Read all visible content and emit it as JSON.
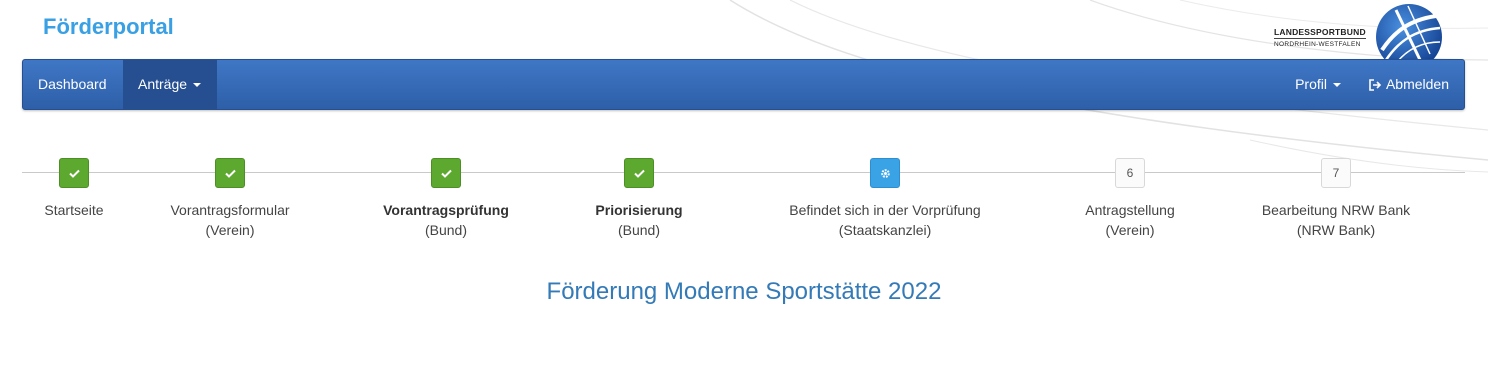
{
  "brand": {
    "title": "Förderportal"
  },
  "logo": {
    "line1": "LANDESSPORTBUND",
    "line2": "NORDRHEIN-WESTFALEN"
  },
  "nav": {
    "left": [
      {
        "label": "Dashboard",
        "active": false,
        "dropdown": false
      },
      {
        "label": "Anträge",
        "active": true,
        "dropdown": true
      }
    ],
    "profile_label": "Profil",
    "logout_label": "Abmelden"
  },
  "steps": [
    {
      "state": "done",
      "badge": "",
      "title": "Startseite",
      "subtitle": "",
      "bold": false
    },
    {
      "state": "done",
      "badge": "",
      "title": "Vorantragsformular",
      "subtitle": "(Verein)",
      "bold": false
    },
    {
      "state": "done",
      "badge": "",
      "title": "Vorantragsprüfung",
      "subtitle": "(Bund)",
      "bold": true
    },
    {
      "state": "done",
      "badge": "",
      "title": "Priorisierung",
      "subtitle": "(Bund)",
      "bold": true
    },
    {
      "state": "current",
      "badge": "",
      "title": "Befindet sich in der Vorprüfung",
      "subtitle": "(Staatskanzlei)",
      "bold": false
    },
    {
      "state": "todo",
      "badge": "6",
      "title": "Antragstellung",
      "subtitle": "(Verein)",
      "bold": false
    },
    {
      "state": "todo",
      "badge": "7",
      "title": "Bearbeitung NRW Bank",
      "subtitle": "(NRW Bank)",
      "bold": false
    }
  ],
  "headline": "Förderung Moderne Sportstätte 2022",
  "icons": {
    "done": "check-icon",
    "current": "gear-icon",
    "logout": "sign-out-icon",
    "caret": "caret-down-icon"
  },
  "colors": {
    "brand": "#3aa0e4",
    "navbar": "#3469b6",
    "done": "#5da92f",
    "current": "#39a3e6",
    "headline": "#337ab7"
  }
}
